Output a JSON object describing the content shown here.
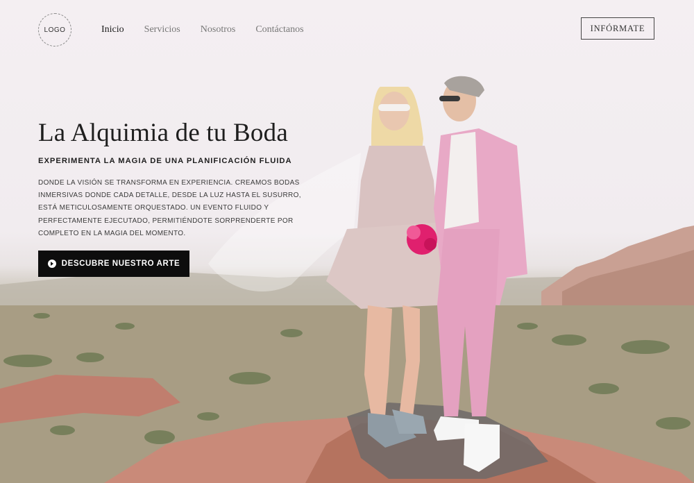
{
  "header": {
    "logo_text": "LOGO",
    "nav": [
      {
        "label": "Inicio",
        "active": true
      },
      {
        "label": "Servicios",
        "active": false
      },
      {
        "label": "Nosotros",
        "active": false
      },
      {
        "label": "Contáctanos",
        "active": false
      }
    ],
    "cta_label": "INFÓRMATE"
  },
  "hero": {
    "title": "La Alquimia de tu Boda",
    "subtitle": "EXPERIMENTA LA MAGIA DE UNA PLANIFICACIÓN FLUIDA",
    "description": "DONDE LA VISIÓN SE TRANSFORMA EN EXPERIENCIA. CREAMOS BODAS INMERSIVAS DONDE CADA DETALLE, DESDE LA LUZ HASTA EL SUSURRO, ESTÁ METICULOSAMENTE ORQUESTADO. UN EVENTO FLUIDO Y PERFECTAMENTE EJECUTADO, PERMITIÉNDOTE SORPRENDERTE POR COMPLETO EN LA MAGIA DEL MOMENTO.",
    "cta_label": "DESCUBRE NUESTRO ARTE",
    "cta_icon": "play-circle-icon",
    "background_image": "couple-in-desert-photo"
  },
  "colors": {
    "accent": "#0d0d0d",
    "suit_pink": "#e8a9c6",
    "dress_blush": "#d9c2c1"
  }
}
